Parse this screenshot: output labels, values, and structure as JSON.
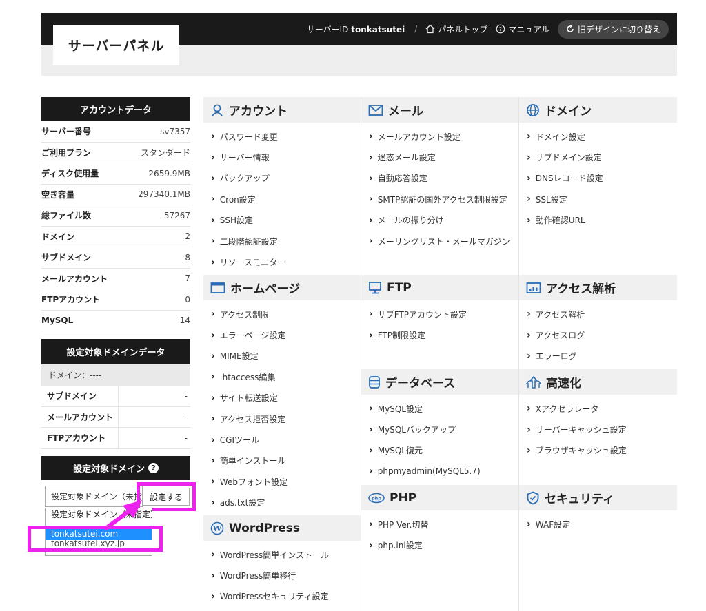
{
  "header": {
    "title": "サーバーパネル",
    "server_id_label": "サーバーID",
    "server_id": "tonkatsutei",
    "separator": "/",
    "panel_top": "パネルトップ",
    "manual": "マニュアル",
    "switch_design": "旧デザインに切り替え"
  },
  "account": {
    "title": "アカウントデータ",
    "rows": [
      {
        "label": "サーバー番号",
        "value": "sv7357"
      },
      {
        "label": "ご利用プラン",
        "value": "スタンダード"
      },
      {
        "label": "ディスク使用量",
        "value": "2659.9MB"
      },
      {
        "label": "空き容量",
        "value": "297340.1MB"
      },
      {
        "label": "総ファイル数",
        "value": "57267"
      },
      {
        "label": "ドメイン",
        "value": "2"
      },
      {
        "label": "サブドメイン",
        "value": "8"
      },
      {
        "label": "メールアカウント",
        "value": "7"
      },
      {
        "label": "FTPアカウント",
        "value": "0"
      },
      {
        "label": "MySQL",
        "value": "14"
      }
    ]
  },
  "domain_data": {
    "title": "設定対象ドメインデータ",
    "domain_line": "ドメイン：----",
    "rows": [
      {
        "label": "サブドメイン",
        "value": "-"
      },
      {
        "label": "メールアカウント",
        "value": "-"
      },
      {
        "label": "FTPアカウント",
        "value": "-"
      }
    ]
  },
  "domain_select": {
    "title": "設定対象ドメイン",
    "help": "?",
    "current": "設定対象ドメイン（未指定）",
    "button": "設定する",
    "options": [
      {
        "label": "設定対象ドメイン（未指定）"
      },
      {
        "label": "..................................."
      },
      {
        "label": "tonkatsutei.com"
      },
      {
        "label": "tonkatsutei.xyz.jp"
      }
    ]
  },
  "sections": {
    "account": {
      "title": "アカウント",
      "icon": "person-icon",
      "items": [
        "パスワード変更",
        "サーバー情報",
        "バックアップ",
        "Cron設定",
        "SSH設定",
        "二段階認証設定",
        "リソースモニター"
      ]
    },
    "mail": {
      "title": "メール",
      "icon": "envelope-icon",
      "items": [
        "メールアカウント設定",
        "迷惑メール設定",
        "自動応答設定",
        "SMTP認証の国外アクセス制限設定",
        "メールの振り分け",
        "メーリングリスト・メールマガジン"
      ]
    },
    "domain": {
      "title": "ドメイン",
      "icon": "globe-icon",
      "items": [
        "ドメイン設定",
        "サブドメイン設定",
        "DNSレコード設定",
        "SSL設定",
        "動作確認URL"
      ]
    },
    "homepage": {
      "title": "ホームページ",
      "icon": "window-icon",
      "items": [
        "アクセス制限",
        "エラーページ設定",
        "MIME設定",
        ".htaccess編集",
        "サイト転送設定",
        "アクセス拒否設定",
        "CGIツール",
        "簡単インストール",
        "Webフォント設定",
        "ads.txt設定"
      ]
    },
    "ftp": {
      "title": "FTP",
      "icon": "monitor-icon",
      "items": [
        "サブFTPアカウント設定",
        "FTP制限設定"
      ]
    },
    "analytics": {
      "title": "アクセス解析",
      "icon": "bar-chart-icon",
      "items": [
        "アクセス解析",
        "アクセスログ",
        "エラーログ"
      ]
    },
    "database": {
      "title": "データベース",
      "icon": "database-icon",
      "items": [
        "MySQL設定",
        "MySQLバックアップ",
        "MySQL復元",
        "phpmyadmin(MySQL5.7)"
      ]
    },
    "speed": {
      "title": "高速化",
      "icon": "rocket-icon",
      "items": [
        "Xアクセラレータ",
        "サーバーキャッシュ設定",
        "ブラウザキャッシュ設定"
      ]
    },
    "php": {
      "title": "PHP",
      "icon": "php-icon",
      "items": [
        "PHP Ver.切替",
        "php.ini設定"
      ]
    },
    "security": {
      "title": "セキュリティ",
      "icon": "shield-icon",
      "items": [
        "WAF設定"
      ]
    },
    "wordpress": {
      "title": "WordPress",
      "icon": "wordpress-icon",
      "items": [
        "WordPress簡単インストール",
        "WordPress簡単移行",
        "WordPressセキュリティ設定"
      ]
    }
  },
  "annotation_color": "#ee22ee"
}
